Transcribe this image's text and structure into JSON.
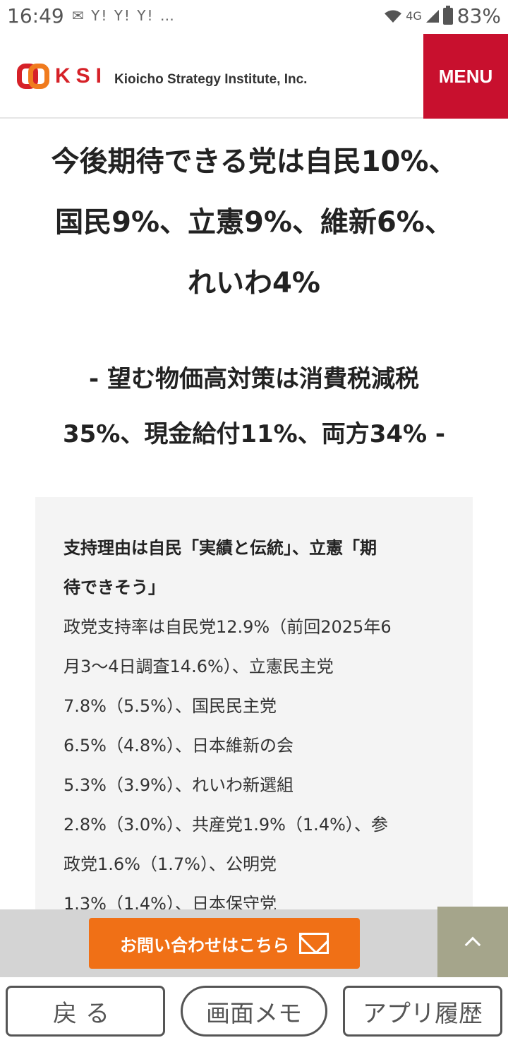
{
  "status_bar": {
    "time": "16:49",
    "notification_icons": "✉ Y! Y! Y! …",
    "network": "4G",
    "battery": "83%"
  },
  "header": {
    "logo_mark": "KSI",
    "logo_name": "Kioicho Strategy Institute, Inc.",
    "menu_label": "MENU"
  },
  "article": {
    "headline_lines": [
      "今後期待できる党は自民10%、",
      "国民9%、立憲9%、維新6%、",
      "れいわ4%"
    ],
    "subhead_lines": [
      "- 望む物価高対策は消費税減税",
      "35%、現金給付11%、両方34% -"
    ]
  },
  "summary_box": {
    "title_lines": [
      "支持理由は自民「実績と伝統」、立憲「期",
      "待できそう」"
    ],
    "body_lines": [
      "政党支持率は自民党12.9%（前回2025年6",
      "月3〜4日調査14.6%）、立憲民主党",
      "7.8%（5.5%）、国民民主党",
      "6.5%（4.8%）、日本維新の会",
      "5.3%（3.9%）、れいわ新選組",
      "2.8%（3.0%）、共産党1.9%（1.4%）、参",
      "政党1.6%（1.7%）、公明党",
      "1.3%（1.4%）、日本保守党"
    ]
  },
  "contact": {
    "button_label": "お問い合わせはこちら",
    "icon": "mail-icon"
  },
  "scroll_top": {
    "icon": "chevron-up-icon"
  },
  "browser_toolbar": {
    "back_label": "戻る",
    "memo_label": "画面メモ",
    "history_label": "アプリ履歴"
  }
}
